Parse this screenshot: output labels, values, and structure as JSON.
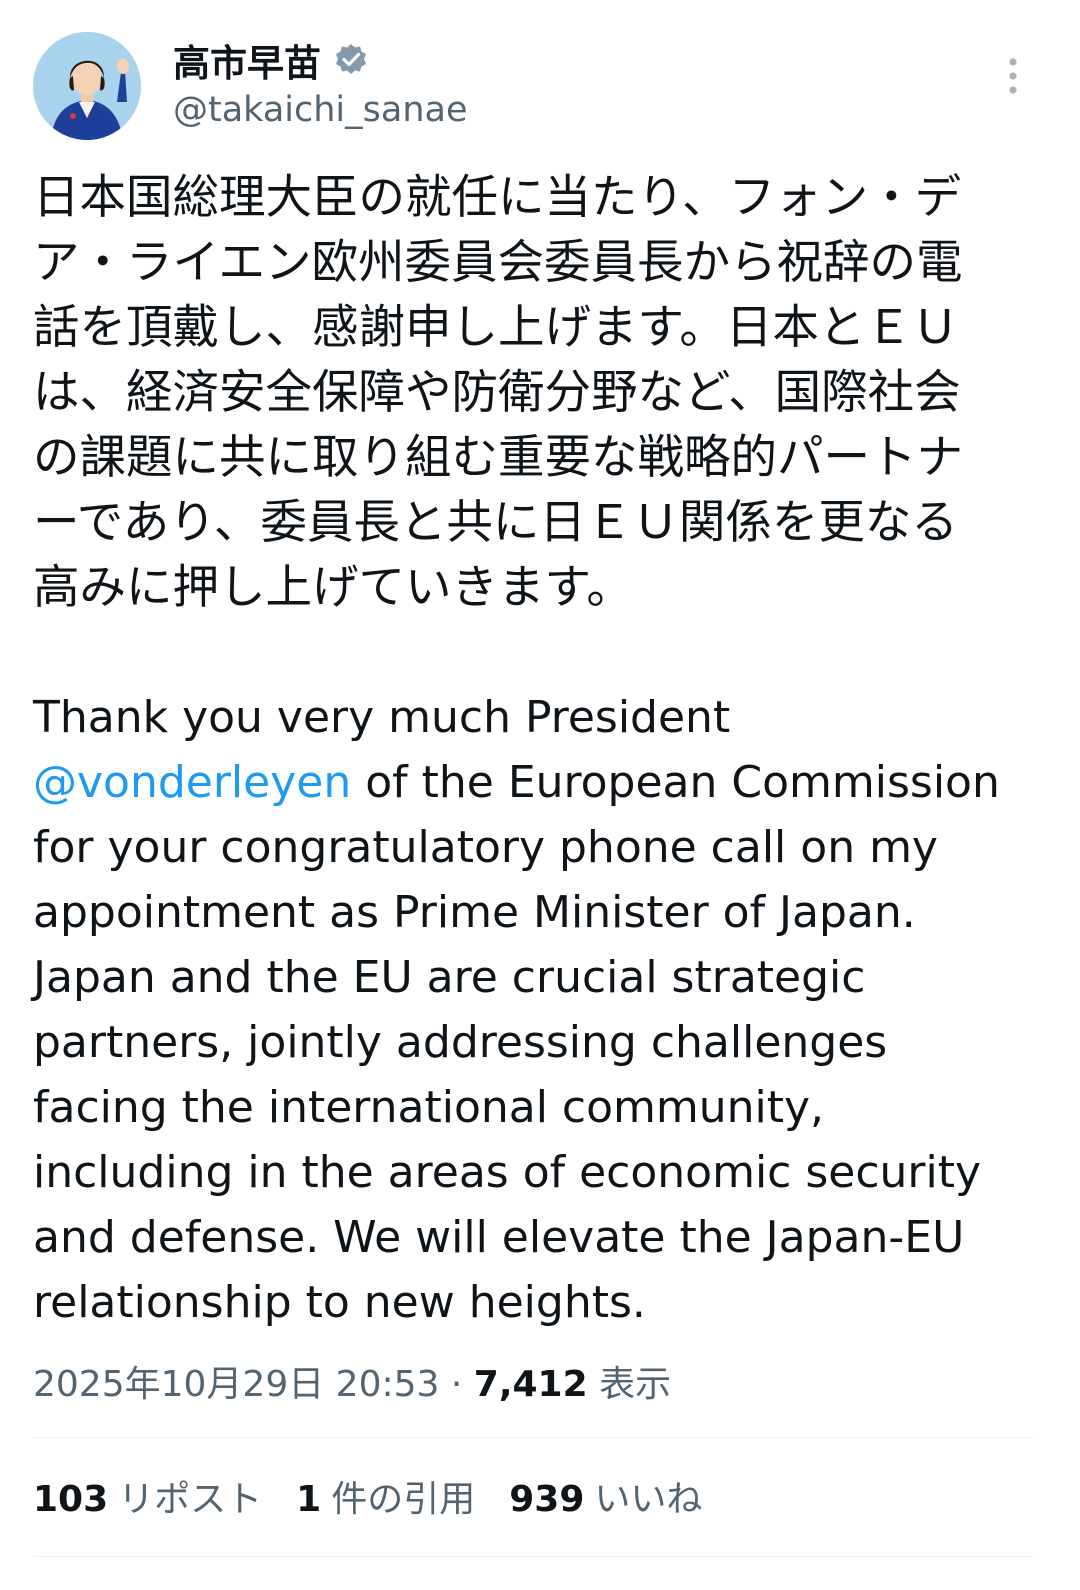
{
  "author": {
    "display_name": "高市早苗",
    "handle": "@takaichi_sanae",
    "verified_icon": "verified-badge-icon",
    "avatar_icon": "profile-photo"
  },
  "tweet": {
    "jp_lines": [
      "日本国総理大臣の就任に当たり、フォン・デ",
      "ア・ライエン欧州委員会委員長から祝辞の電",
      "話を頂戴し、感謝申し上げます。日本とＥＵ",
      "は、経済安全保障や防衛分野など、国際社会",
      "の課題に共に取り組む重要な戦略的パートナ",
      "ーであり、委員長と共に日ＥＵ関係を更なる",
      "高みに押し上げていきます。"
    ],
    "en_line_1": "Thank you very much President",
    "mention": "@vonderleyen",
    "en_line_2_rest": " of the European Commission",
    "en_lines_rest": [
      "for your congratulatory phone call on my",
      "appointment as Prime Minister of Japan.",
      "Japan and the EU are crucial strategic",
      "partners, jointly addressing challenges",
      "facing the international community,",
      "including in the areas of economic security",
      "and defense. We will elevate the Japan-EU",
      "relationship to new heights."
    ]
  },
  "meta": {
    "timestamp": "2025年10月29日 20:53",
    "separator": " · ",
    "views_count": "7,412",
    "views_label": "表示"
  },
  "stats": {
    "reposts_count": "103",
    "reposts_label": "リポスト",
    "quotes_count": "1",
    "quotes_label": "件の引用",
    "likes_count": "939",
    "likes_label": "いいね"
  },
  "colors": {
    "text": "#0f1419",
    "secondary": "#536471",
    "link": "#1d9bf0",
    "divider": "#eff3f4"
  }
}
